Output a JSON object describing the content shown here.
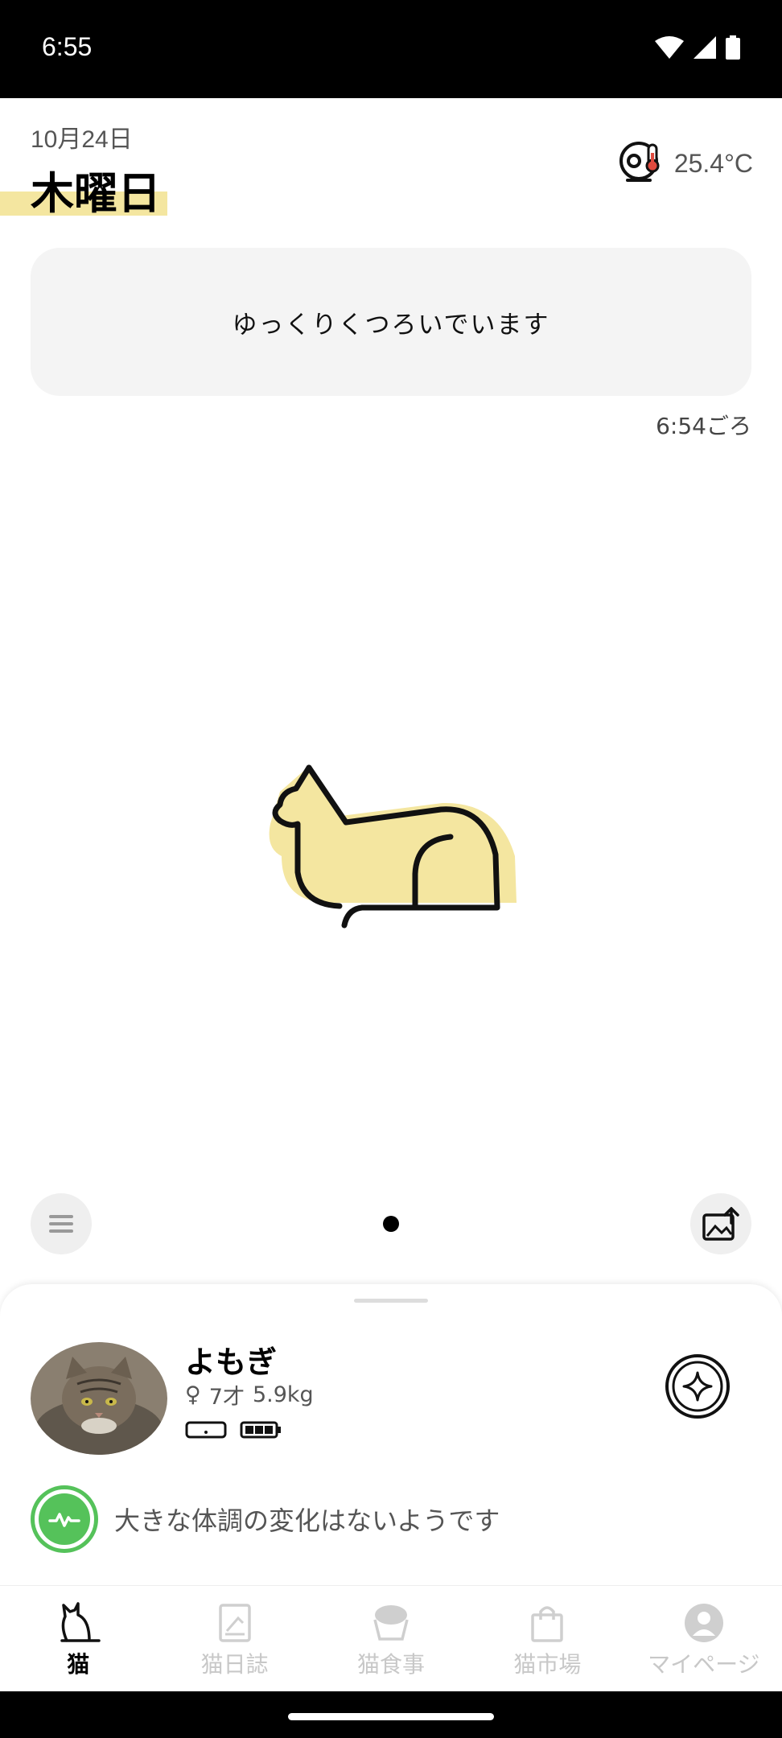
{
  "status_bar": {
    "time": "6:55",
    "icons": [
      "wifi-icon",
      "signal-icon",
      "battery-icon"
    ]
  },
  "header": {
    "date": "10月24日",
    "day": "木曜日",
    "temperature": "25.4°C",
    "temperature_icon": "camera-thermometer-icon"
  },
  "activity": {
    "message": "ゆっくりくつろいでいます",
    "time_note": "6:54ごろ"
  },
  "controls": {
    "left_icon": "list-icon",
    "right_icon": "share-image-icon",
    "page_index": 1,
    "page_count": 1
  },
  "pet": {
    "name": "よもぎ",
    "sex_symbol": "♀",
    "age": "7才",
    "weight": "5.9kg",
    "devices": [
      "device-icon",
      "battery-full-icon"
    ]
  },
  "health": {
    "message": "大きな体調の変化はないようです"
  },
  "tabs": [
    {
      "label": "猫",
      "icon": "cat-icon",
      "active": true
    },
    {
      "label": "猫日誌",
      "icon": "diary-icon",
      "active": false
    },
    {
      "label": "猫食事",
      "icon": "food-bowl-icon",
      "active": false
    },
    {
      "label": "猫市場",
      "icon": "shopping-bag-icon",
      "active": false
    },
    {
      "label": "マイページ",
      "icon": "profile-icon",
      "active": false
    }
  ],
  "colors": {
    "accent_yellow": "#f4e6a0",
    "health_green": "#55c25a",
    "card_bg": "#f4f4f4",
    "inactive_tab": "#c8c8c8"
  }
}
